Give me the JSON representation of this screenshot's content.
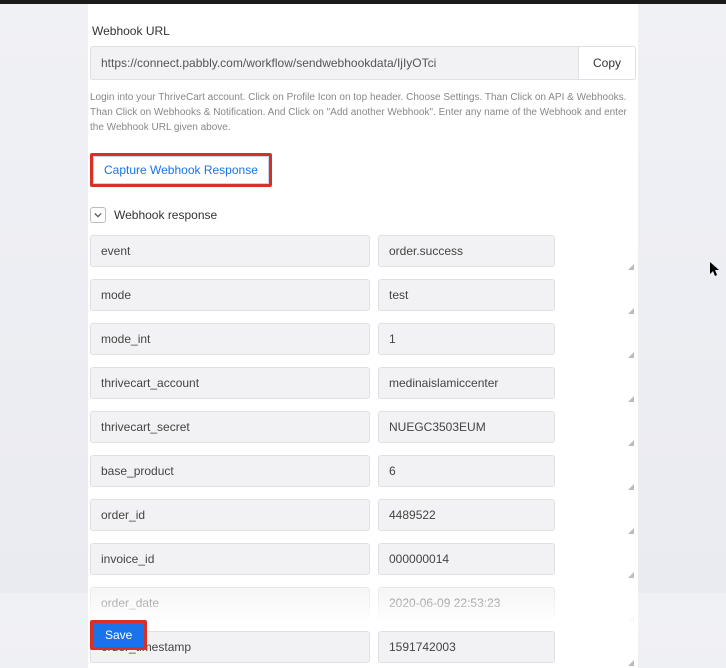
{
  "webhook": {
    "label": "Webhook URL",
    "url": "https://connect.pabbly.com/workflow/sendwebhookdata/IjIyOTci",
    "copy_label": "Copy",
    "help_text": "Login into your ThriveCart account. Click on Profile Icon on top header. Choose Settings. Than Click on API & Webhooks.  Than Click on Webhooks & Notification. And Click on \"Add another Webhook\". Enter any name of the Webhook and enter the Webhook URL given above.",
    "capture_label": "Capture Webhook Response"
  },
  "response": {
    "title": "Webhook response",
    "fields": [
      {
        "key": "event",
        "value": "order.success"
      },
      {
        "key": "mode",
        "value": "test"
      },
      {
        "key": "mode_int",
        "value": "1"
      },
      {
        "key": "thrivecart_account",
        "value": "medinaislamiccenter"
      },
      {
        "key": "thrivecart_secret",
        "value": "NUEGC3503EUM"
      },
      {
        "key": "base_product",
        "value": "6"
      },
      {
        "key": "order_id",
        "value": "4489522"
      },
      {
        "key": "invoice_id",
        "value": "000000014"
      },
      {
        "key": "order_date",
        "value": "2020-06-09 22:53:23"
      },
      {
        "key": "order_timestamp",
        "value": "1591742003"
      }
    ]
  },
  "actions": {
    "save_label": "Save"
  }
}
